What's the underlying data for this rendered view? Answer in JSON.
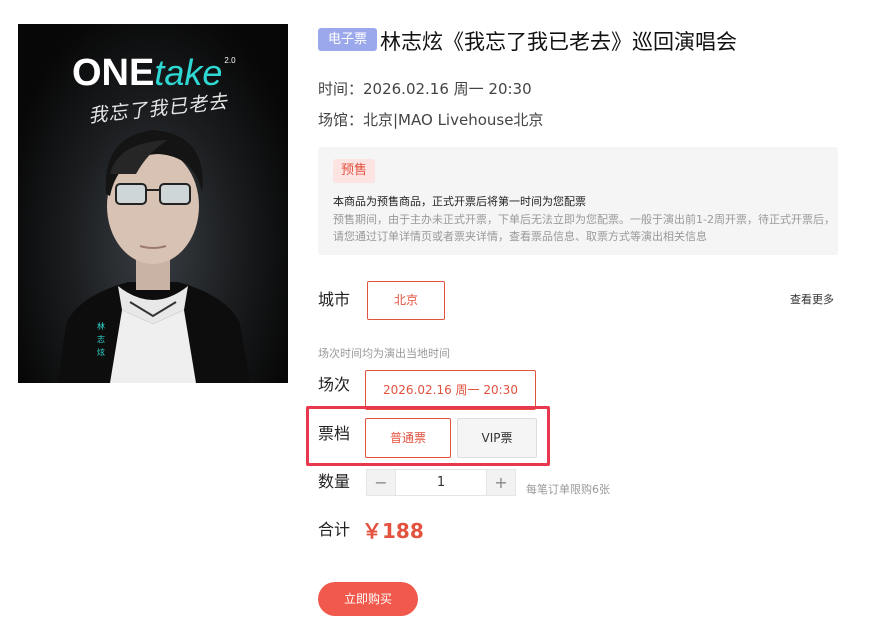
{
  "poster": {
    "logo_one": "ONE",
    "logo_take": "take",
    "logo_version": "2.0",
    "script_text": "我忘了我已老去",
    "vertical_name": "林志炫"
  },
  "event": {
    "badge": "电子票",
    "title": "林志炫《我忘了我已老去》巡回演唱会",
    "time": "时间：2026.02.16 周一 20:30",
    "venue": "场馆：北京|MAO Livehouse北京"
  },
  "notice": {
    "tag": "预售",
    "main": "本商品为预售商品，正式开票后将第一时间为您配票",
    "desc": "预售期间，由于主办未正式开票，下单后无法立即为您配票。一般于演出前1-2周开票，待正式开票后，请您通过订单详情页或者票夹详情，查看票品信息、取票方式等演出相关信息"
  },
  "city": {
    "label": "城市",
    "options": [
      "北京"
    ],
    "selected": "北京",
    "more": "查看更多"
  },
  "session": {
    "hint": "场次时间均为演出当地时间",
    "label": "场次",
    "options": [
      "2026.02.16 周一 20:30"
    ]
  },
  "tier": {
    "label": "票档",
    "options": [
      "普通票",
      "VIP票"
    ],
    "selected": "普通票"
  },
  "quantity": {
    "label": "数量",
    "minus": "−",
    "plus": "+",
    "value": "1",
    "limit": "每笔订单限购6张"
  },
  "total": {
    "label": "合计",
    "price": "￥188"
  },
  "buy_label": "立即购买",
  "colors": {
    "accent": "#e2523f",
    "badge": "#9ba8ec",
    "highlight": "#e8384f",
    "buy": "#f0594c"
  }
}
